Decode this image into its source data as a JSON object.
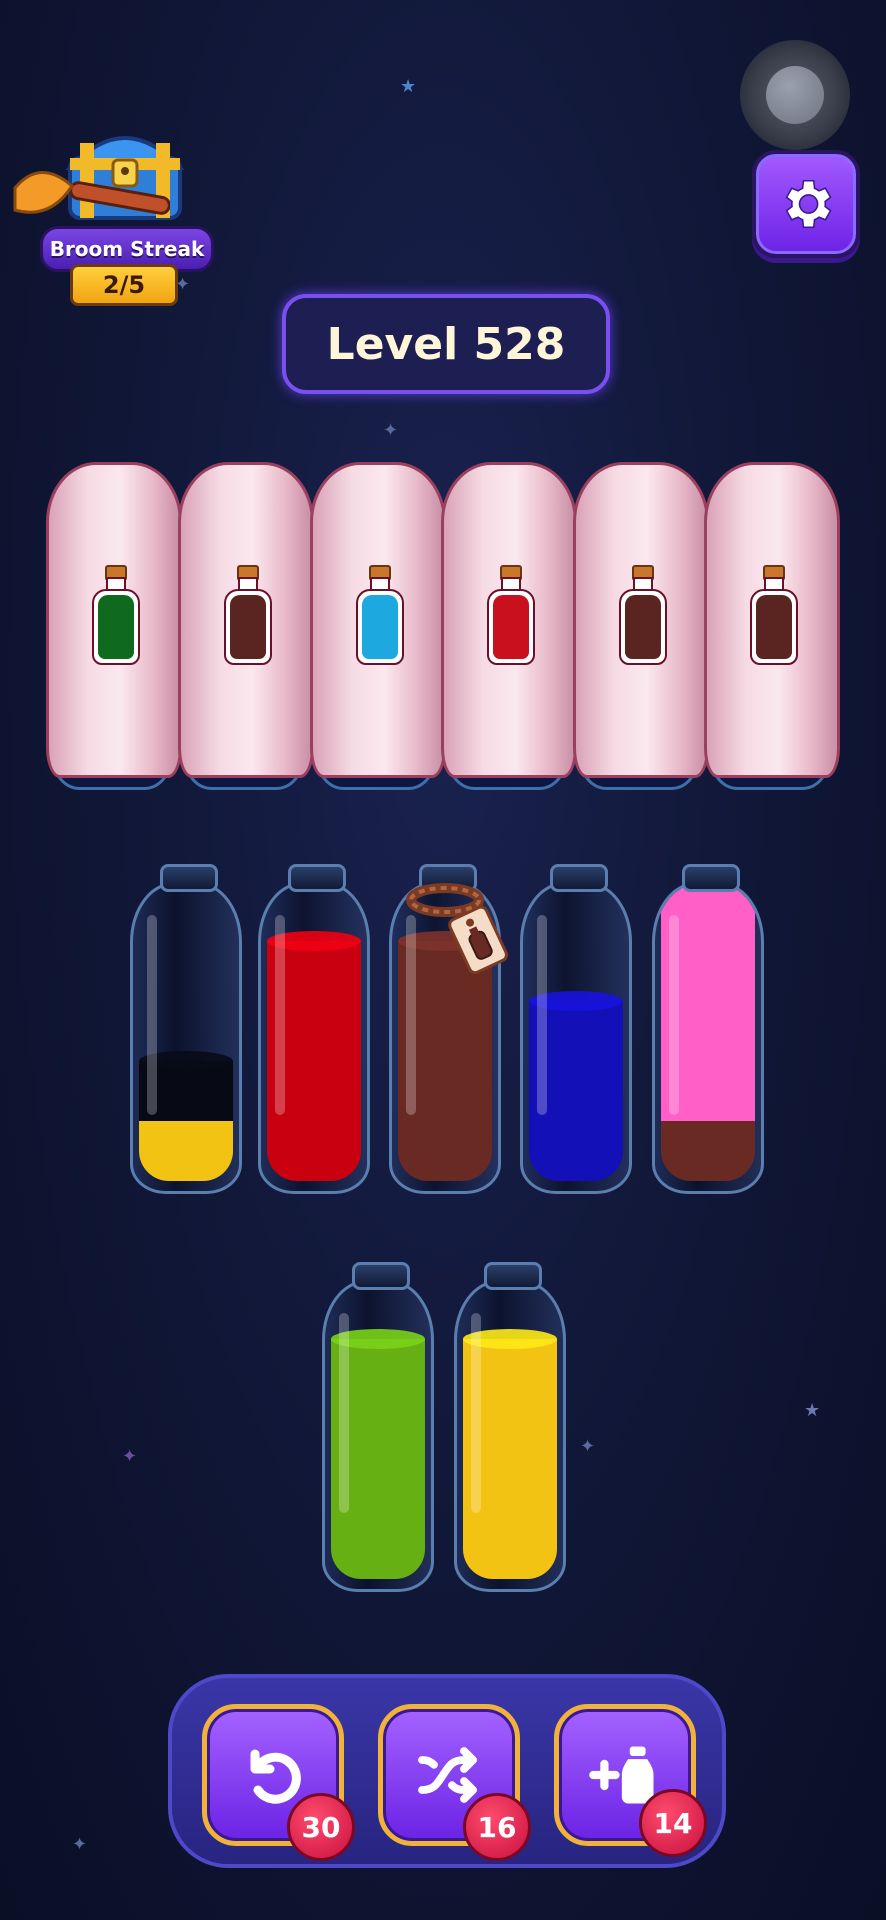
{
  "broom_streak": {
    "label": "Broom Streak",
    "count": "2/5"
  },
  "level": {
    "label": "Level 528"
  },
  "covered_bottles": [
    {
      "hint_color": "#0f6a1d"
    },
    {
      "hint_color": "#5a2420"
    },
    {
      "hint_color": "#1ea8e0"
    },
    {
      "hint_color": "#c8101e"
    },
    {
      "hint_color": "#5a2420"
    },
    {
      "hint_color": "#5a2420"
    }
  ],
  "tubes_row1": [
    {
      "layers": [
        {
          "color": "#f3c313",
          "units": 1
        },
        {
          "color": "#070914",
          "units": 1
        }
      ]
    },
    {
      "layers": [
        {
          "color": "#c8000f",
          "units": 4
        }
      ]
    },
    {
      "layers": [
        {
          "color": "#6a2a24",
          "units": 4
        }
      ],
      "locked": true
    },
    {
      "layers": [
        {
          "color": "#1410b8",
          "units": 3
        }
      ]
    },
    {
      "layers": [
        {
          "color": "#6a2a24",
          "units": 1
        },
        {
          "color": "#ff5fc6",
          "units": 4
        }
      ]
    }
  ],
  "tubes_row2": [
    {
      "layers": [
        {
          "color": "#66b014",
          "units": 4
        }
      ]
    },
    {
      "layers": [
        {
          "color": "#f3c313",
          "units": 4
        }
      ]
    }
  ],
  "tools": {
    "undo": {
      "icon": "undo-icon",
      "count": "30"
    },
    "shuffle": {
      "icon": "shuffle-icon",
      "count": "16"
    },
    "add_tube": {
      "icon": "add-tube-icon",
      "count": "14"
    }
  }
}
